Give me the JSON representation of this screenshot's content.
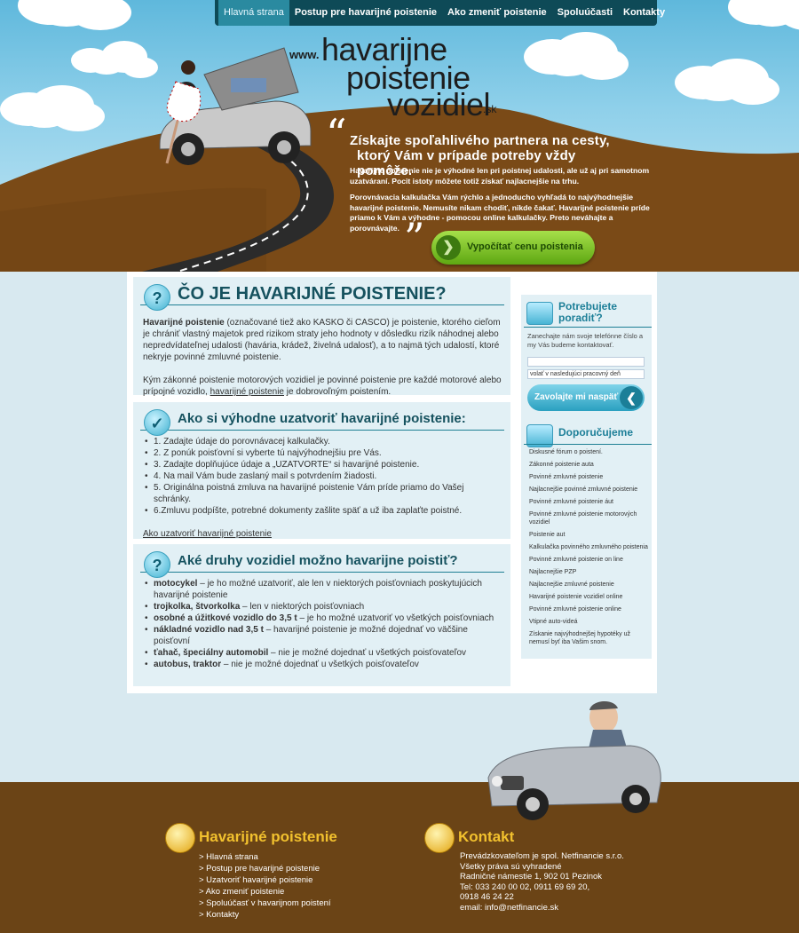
{
  "nav": {
    "items": [
      "Hlavná strana",
      "Postup pre havarijné poistenie",
      "Ako zmeniť poistenie",
      "Spoluúčasti",
      "Kontakty"
    ]
  },
  "logo": {
    "www": "www.",
    "line1": "havarijne",
    "line2": "poistenie",
    "line3": "vozidiel",
    "tld": ".sk"
  },
  "hero": {
    "tagline_1": "Získajte spoľahlivého partnera na cesty,",
    "tagline_2": "ktorý Vám v prípade potreby vždy pomôže.",
    "p1": "Havarijné poistenie nie je výhodné len pri poistnej udalosti, ale už aj pri samotnom uzatváraní. Pocit istoty môžete totiž získať najlacnejšie na trhu.",
    "p2": "Porovnávacia kalkulačka Vám rýchlo a jednoducho vyhľadá to najvýhodnejšie havarijné poistenie. Nemusíte nikam chodiť, nikde čakať. Havarijné poistenie príde priamo k Vám a výhodne - pomocou online kalkulačky. Preto neváhajte a porovnávajte.",
    "cta": "Vypočítať cenu poistenia"
  },
  "box1": {
    "title": "ČO JE HAVARIJNÉ POISTENIE?",
    "p1_bold": "Havarijné poistenie",
    "p1_rest": " (označované tiež ako KASKO či CASCO) je poistenie, ktorého cieľom je chrániť vlastný majetok pred rizikom straty jeho hodnoty v dôsledku rizík náhodnej alebo nepredvídateľnej udalosti (havária, krádež, živelná udalosť), a to najmä tých udalostí, ktoré nekryje povinné zmluvné poistenie.",
    "p2_a": "Kým zákonné poistenie motorových vozidiel je povinné poistenie pre každé motorové alebo prípojné vozidlo, ",
    "p2_link": "havarijné poistenie",
    "p2_b": " je dobrovoľným poistením."
  },
  "box2": {
    "title": "Ako si výhodne uzatvoriť havarijné poistenie:",
    "items": [
      "1. Zadajte údaje do porovnávacej kalkulačky.",
      "2. Z ponúk poisťovní si vyberte tú najvýhodnejšiu pre Vás.",
      "3. Zadajte doplňujúce údaje a „UZATVORTE“ si havarijné poistenie.",
      "4. Na mail Vám bude zaslaný mail s potvrdením žiadosti.",
      "5. Originálna poistná zmluva na havarijné poistenie Vám príde priamo do Vašej schránky.",
      "6.Zmluvu podpíšte, potrebné dokumenty zašlite späť a už iba zaplaťte poistné."
    ],
    "link": "Ako uzatvoriť havarijné poistenie"
  },
  "box3": {
    "title": "Aké druhy vozidiel možno havarijne poistiť?",
    "items": [
      {
        "bold": "motocykel",
        "rest": " – je ho možné uzatvoriť, ale len v niektorých poisťovniach poskytujúcich havarijné poistenie"
      },
      {
        "bold": "trojkolka, štvorkolka",
        "rest": " – len v niektorých poisťovniach"
      },
      {
        "bold": "osobné a úžitkové vozidlo do 3,5 t",
        "rest": " – je ho možné uzatvoriť vo všetkých poisťovniach"
      },
      {
        "bold": "nákladné vozidlo nad 3,5 t",
        "rest": " – havarijné poistenie je možné dojednať vo väčšine poisťovní"
      },
      {
        "bold": "ťahač, špeciálny automobil",
        "rest": " – nie je možné dojednať u všetkých poisťovateľov"
      },
      {
        "bold": "autobus, traktor",
        "rest": " – nie je možné dojednať u všetkých poisťovateľov"
      }
    ]
  },
  "sidebar": {
    "advice_title_1": "Potrebujete",
    "advice_title_2": "poradiť?",
    "advice_text": "Zanechajte nám svoje telefónne číslo a my Vás budeme kontaktovať.",
    "phone_value": "",
    "select_value": "volať v nasledujúci pracovný deň",
    "call_button": "Zavolajte mi naspäť",
    "rec_title": "Doporučujeme",
    "links": [
      "Diskusné fórum o poistení.",
      "Zákonné poistenie auta",
      "Povinné zmluvné poistenie",
      "Najlacnejšie povinné zmluvné poistenie",
      "Povinné zmluvné poistenie áut",
      "Povinné zmluvné poistenie motorových vozidiel",
      "Poistenie aut",
      "Kalkulačka povinného zmluvného poistenia",
      "Povinné zmluvné poistenie on line",
      "Najlacnejšie PZP",
      "Najlacnejšie zmluvné poistenie",
      "Havarijné poistenie vozidiel online",
      "Povinné zmluvné poistenie online",
      "Vtipné auto-videá",
      "Získanie najvýhodnejšej hypotéky už nemusí byť iba Vašim snom."
    ]
  },
  "footer": {
    "col1_title": "Havarijné poistenie",
    "col1_links": [
      "> Hlavná strana",
      "> Postup pre havarijné poistenie",
      "> Uzatvoriť havarijné poistenie",
      "> Ako zmeniť poistenie",
      "> Spoluúčasť v havarijnom poistení",
      "> Kontakty"
    ],
    "col2_title": "Kontakt",
    "contact_lines": [
      "Prevádzkovateľom je spol. Netfinancie s.r.o.",
      "Všetky práva sú vyhradené",
      "Radničné námestie 1, 902 01 Pezinok",
      "Tel: 033 240 00 02, 0911 69 69 20,",
      "0918 46 24 22",
      "email: info@netfinancie.sk"
    ]
  }
}
